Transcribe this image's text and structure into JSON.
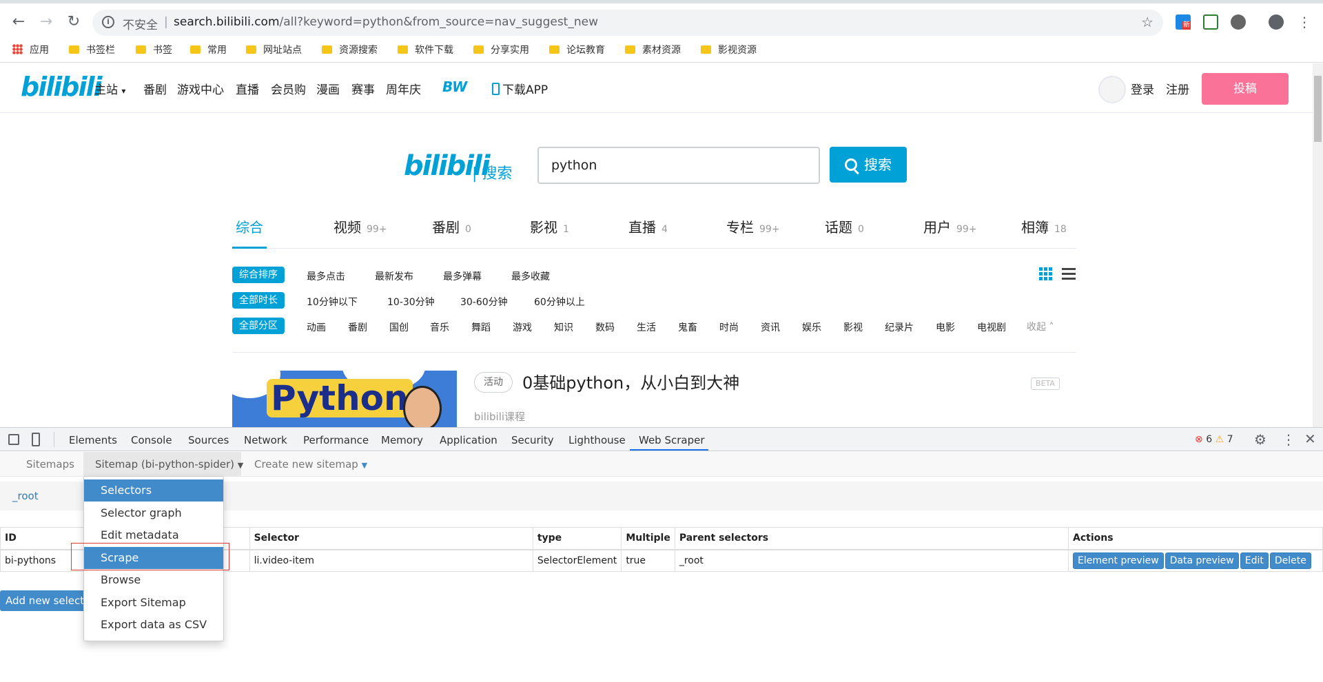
{
  "browser": {
    "insecure_label": "不安全",
    "url_host": "search.bilibili.com",
    "url_path": "/all?keyword=python&from_source=nav_suggest_new",
    "ext_badge": "新"
  },
  "bookmarks": [
    "应用",
    "书签栏",
    "书签",
    "常用",
    "网址站点",
    "资源搜索",
    "软件下载",
    "分享实用",
    "论坛教育",
    "素材资源",
    "影视资源"
  ],
  "bili": {
    "logo": "bilibili",
    "nav": [
      "主站",
      "番剧",
      "游戏中心",
      "直播",
      "会员购",
      "漫画",
      "赛事",
      "周年庆"
    ],
    "bw": "BW",
    "download": "下载APP",
    "login": "登录",
    "register": "注册",
    "upload": "投稿",
    "search_label": "| 搜索",
    "search_value": "python",
    "search_button": "搜索",
    "result_tabs": [
      {
        "label": "综合",
        "count": ""
      },
      {
        "label": "视频",
        "count": "99+"
      },
      {
        "label": "番剧",
        "count": "0"
      },
      {
        "label": "影视",
        "count": "1"
      },
      {
        "label": "直播",
        "count": "4"
      },
      {
        "label": "专栏",
        "count": "99+"
      },
      {
        "label": "话题",
        "count": "0"
      },
      {
        "label": "用户",
        "count": "99+"
      },
      {
        "label": "相簿",
        "count": "18"
      }
    ],
    "sort_active": "综合排序",
    "sort_options": [
      "最多点击",
      "最新发布",
      "最多弹幕",
      "最多收藏"
    ],
    "duration_active": "全部时长",
    "duration_options": [
      "10分钟以下",
      "10-30分钟",
      "30-60分钟",
      "60分钟以上"
    ],
    "zone_active": "全部分区",
    "zone_options": [
      "动画",
      "番剧",
      "国创",
      "音乐",
      "舞蹈",
      "游戏",
      "知识",
      "数码",
      "生活",
      "鬼畜",
      "时尚",
      "资讯",
      "娱乐",
      "影视",
      "纪录片",
      "电影",
      "电视剧"
    ],
    "collapse": "收起",
    "result": {
      "badge": "活动",
      "title": "0基础python，从小白到大神",
      "author": "bilibili课程",
      "beta": "BETA",
      "thumb_text": "Python"
    }
  },
  "devtools": {
    "tabs": [
      "Elements",
      "Console",
      "Sources",
      "Network",
      "Performance",
      "Memory",
      "Application",
      "Security",
      "Lighthouse",
      "Web Scraper"
    ],
    "errors": "6",
    "warnings": "7"
  },
  "scraper": {
    "nav": [
      "Sitemaps",
      "Sitemap (bi-python-spider)",
      "Create new sitemap"
    ],
    "breadcrumb": "_root",
    "headers": [
      "ID",
      "Selector",
      "type",
      "Multiple",
      "Parent selectors",
      "Actions"
    ],
    "rows": [
      {
        "id": "bi-pythons",
        "selector": "li.video-item",
        "type": "SelectorElement",
        "multiple": "true",
        "parent": "_root"
      }
    ],
    "actions": [
      "Element preview",
      "Data preview",
      "Edit",
      "Delete"
    ],
    "add_selector": "Add new selector",
    "menu": [
      "Selectors",
      "Selector graph",
      "Edit metadata",
      "Scrape",
      "Browse",
      "Export Sitemap",
      "Export data as CSV"
    ]
  }
}
